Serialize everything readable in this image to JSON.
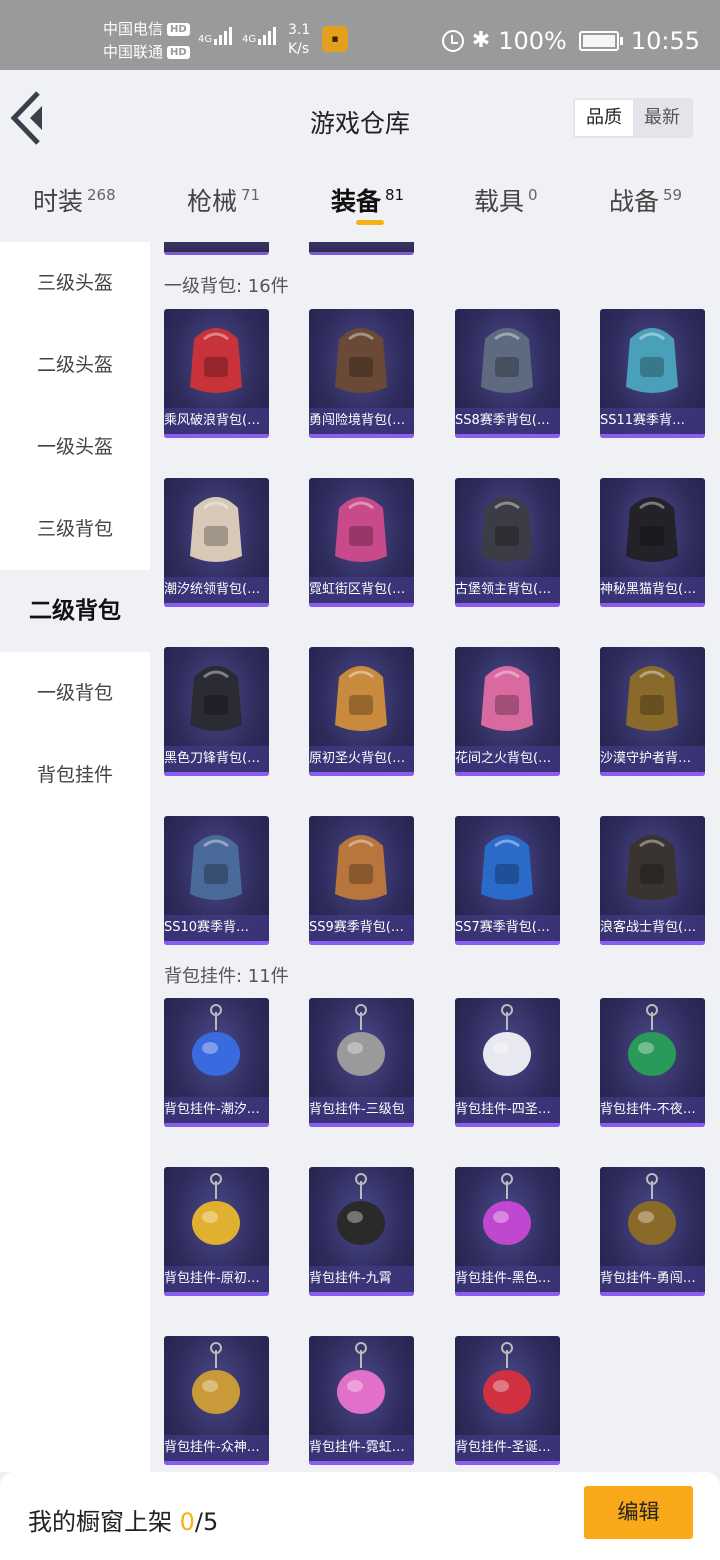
{
  "status_bar": {
    "carrier1": "中国电信",
    "carrier2": "中国联通",
    "hd": "HD",
    "net1": "4G",
    "net2": "4G",
    "speed_value": "3.1",
    "speed_unit": "K/s",
    "battery": "100%",
    "time": "10:55"
  },
  "header": {
    "title": "游戏仓库",
    "sort_options": [
      "品质",
      "最新"
    ],
    "sort_selected": "品质"
  },
  "tabs": [
    {
      "label": "时装",
      "count": "268"
    },
    {
      "label": "枪械",
      "count": "71"
    },
    {
      "label": "装备",
      "count": "81",
      "active": true
    },
    {
      "label": "载具",
      "count": "0"
    },
    {
      "label": "战备",
      "count": "59"
    }
  ],
  "sidebar": {
    "items": [
      "三级头盔",
      "二级头盔",
      "一级头盔",
      "三级背包",
      "二级背包",
      "一级背包",
      "背包挂件"
    ],
    "active": "二级背包"
  },
  "sections": [
    {
      "title": "一级背包: 16件",
      "items": [
        {
          "name": "乘风破浪背包(…",
          "icon": "heart-backpack-icon"
        },
        {
          "name": "勇闯险境背包(…",
          "icon": "anchor-backpack-icon"
        },
        {
          "name": "SS8赛季背包(…",
          "icon": "ss8-backpack-icon"
        },
        {
          "name": "SS11赛季背…",
          "icon": "ss11-backpack-icon"
        },
        {
          "name": "潮汐统领背包(…",
          "icon": "tide-backpack-icon"
        },
        {
          "name": "霓虹街区背包(…",
          "icon": "neon-backpack-icon"
        },
        {
          "name": "古堡领主背包(…",
          "icon": "castle-backpack-icon"
        },
        {
          "name": "神秘黑猫背包(…",
          "icon": "black-cat-backpack-icon"
        },
        {
          "name": "黑色刀锋背包(…",
          "icon": "black-blade-backpack-icon"
        },
        {
          "name": "原初圣火背包(…",
          "icon": "flame-backpack-icon"
        },
        {
          "name": "花间之火背包(…",
          "icon": "flower-backpack-icon"
        },
        {
          "name": "沙漠守护者背…",
          "icon": "anubis-backpack-icon"
        },
        {
          "name": "SS10赛季背…",
          "icon": "ss10-backpack-icon"
        },
        {
          "name": "SS9赛季背包(…",
          "icon": "ss9-backpack-icon"
        },
        {
          "name": "SS7赛季背包(…",
          "icon": "ss7-backpack-icon"
        },
        {
          "name": "浪客战士背包(…",
          "icon": "ronin-backpack-icon"
        }
      ]
    },
    {
      "title": "背包挂件: 11件",
      "items": [
        {
          "name": "背包挂件-潮汐…",
          "icon": "wing-gem-charm-icon"
        },
        {
          "name": "背包挂件-三级包",
          "icon": "mini-backpack-charm-icon"
        },
        {
          "name": "背包挂件-四圣…",
          "icon": "white-ornament-charm-icon"
        },
        {
          "name": "背包挂件-不夜…",
          "icon": "jade-charm-icon"
        },
        {
          "name": "背包挂件-原初…",
          "icon": "medal-charm-icon"
        },
        {
          "name": "背包挂件-九霄",
          "icon": "sword-charm-icon"
        },
        {
          "name": "背包挂件-黑色…",
          "icon": "neon-logo-charm-icon"
        },
        {
          "name": "背包挂件-勇闯…",
          "icon": "treasure-chest-charm-icon"
        },
        {
          "name": "背包挂件-众神…",
          "icon": "winged-emblem-charm-icon"
        },
        {
          "name": "背包挂件-霓虹…",
          "icon": "hologram-charm-icon"
        },
        {
          "name": "背包挂件-圣诞…",
          "icon": "santa-hat-charm-icon"
        }
      ]
    }
  ],
  "footer": {
    "label": "我的橱窗上架",
    "current": "0",
    "total": "/5",
    "edit_label": "编辑"
  },
  "colors": {
    "accent": "#f8a818",
    "card_bg": "#2f2c5d",
    "card_bar": "#8a5cf0"
  }
}
